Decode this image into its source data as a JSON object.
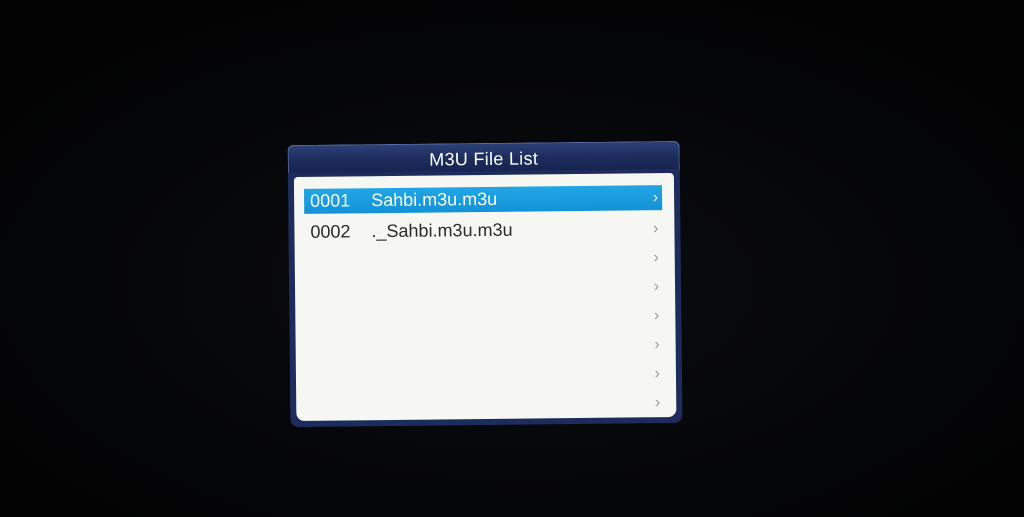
{
  "dialog": {
    "title": "M3U File List",
    "items": [
      {
        "number": "0001",
        "name": "Sahbi.m3u.m3u",
        "selected": true
      },
      {
        "number": "0002",
        "name": "._Sahbi.m3u.m3u",
        "selected": false
      },
      {
        "number": "",
        "name": "",
        "selected": false
      },
      {
        "number": "",
        "name": "",
        "selected": false
      },
      {
        "number": "",
        "name": "",
        "selected": false
      },
      {
        "number": "",
        "name": "",
        "selected": false
      },
      {
        "number": "",
        "name": "",
        "selected": false
      },
      {
        "number": "",
        "name": "",
        "selected": false
      }
    ],
    "row_chevron": "›"
  },
  "colors": {
    "title_bar": "#1d2c5c",
    "selection": "#1a9be0",
    "list_background": "#f6f6f2",
    "backdrop": "#050608"
  }
}
